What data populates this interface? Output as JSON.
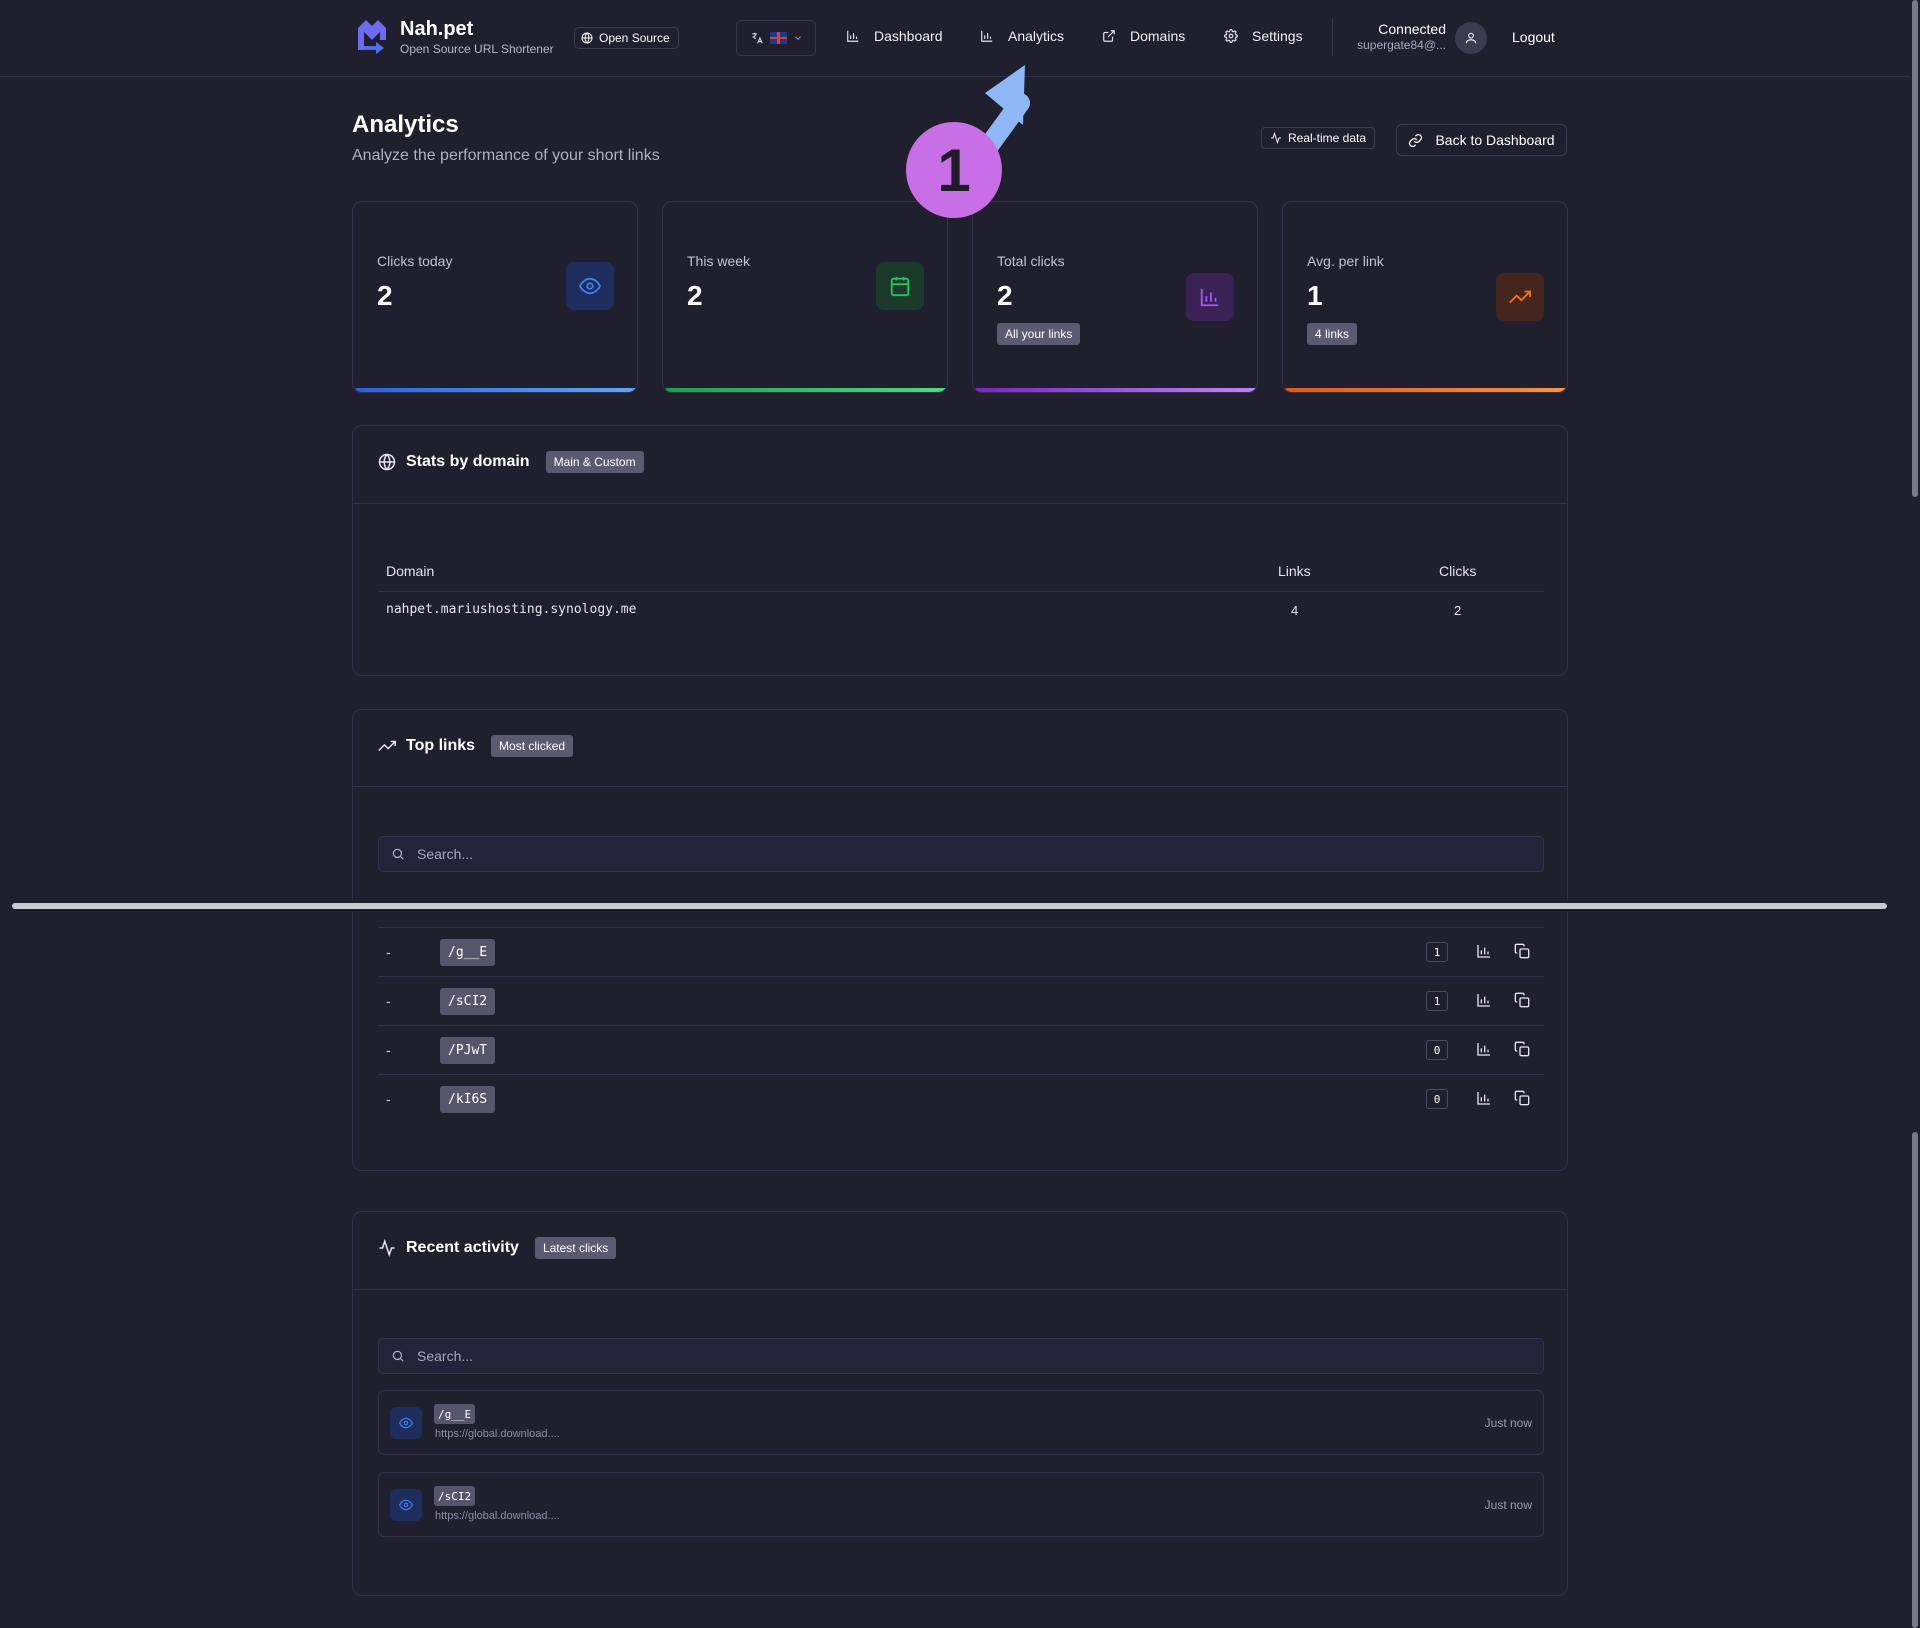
{
  "header": {
    "brand_name": "Nah.pet",
    "brand_sub": "Open Source URL Shortener",
    "open_source_label": "Open Source",
    "nav": {
      "dashboard": "Dashboard",
      "analytics": "Analytics",
      "domains": "Domains",
      "settings": "Settings"
    },
    "user_status": "Connected",
    "user_email": "supergate84@...",
    "logout": "Logout"
  },
  "page": {
    "title": "Analytics",
    "subtitle": "Analyze the performance of your short links",
    "realtime": "Real-time data",
    "back": "Back to Dashboard"
  },
  "stats": {
    "today": {
      "label": "Clicks today",
      "value": "2",
      "color": "#3b82f6"
    },
    "week": {
      "label": "This week",
      "value": "2",
      "color": "#22c55e"
    },
    "total": {
      "label": "Total clicks",
      "value": "2",
      "badge": "All your links",
      "color": "#a855f7"
    },
    "avg": {
      "label": "Avg. per link",
      "value": "1",
      "badge": "4 links",
      "color": "#f97316"
    }
  },
  "domains": {
    "title": "Stats by domain",
    "badge": "Main & Custom",
    "col_domain": "Domain",
    "col_links": "Links",
    "col_clicks": "Clicks",
    "rows": [
      {
        "domain": "nahpet.mariushosting.synology.me",
        "links": "4",
        "clicks": "2"
      }
    ]
  },
  "top_links": {
    "title": "Top links",
    "badge": "Most clicked",
    "search_placeholder": "Search...",
    "rows": [
      {
        "name": "-",
        "slug": "/g__E",
        "clicks": "1"
      },
      {
        "name": "-",
        "slug": "/sCI2",
        "clicks": "1"
      },
      {
        "name": "-",
        "slug": "/PJwT",
        "clicks": "0"
      },
      {
        "name": "-",
        "slug": "/kI6S",
        "clicks": "0"
      }
    ]
  },
  "activity": {
    "title": "Recent activity",
    "badge": "Latest clicks",
    "search_placeholder": "Search...",
    "items": [
      {
        "slug": "/g__E",
        "url": "https://global.download....",
        "time": "Just now"
      },
      {
        "slug": "/sCI2",
        "url": "https://global.download....",
        "time": "Just now"
      }
    ]
  },
  "annotation": {
    "number": "1",
    "color": "#c86ee6"
  }
}
